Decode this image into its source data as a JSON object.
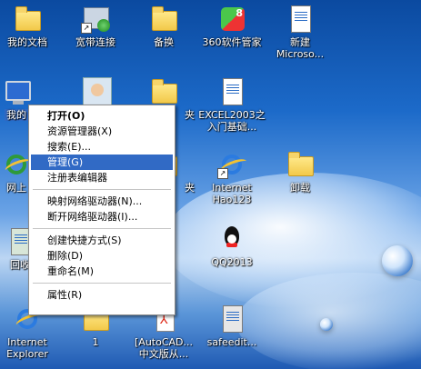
{
  "desktop_icons": [
    {
      "name": "my-documents",
      "label": "我的文档",
      "icon": "folder-icon"
    },
    {
      "name": "broadband",
      "label": "宽带连接",
      "icon": "network-connection-icon"
    },
    {
      "name": "backup",
      "label": "备换",
      "icon": "folder-icon"
    },
    {
      "name": "360-manager",
      "label": "360软件管家",
      "icon": "app-360-icon"
    },
    {
      "name": "new-microsoft",
      "label": "新建\nMicroso...",
      "icon": "document-icon"
    },
    {
      "name": "my-computer",
      "label": "我的",
      "icon": "computer-icon"
    },
    {
      "name": "user-avatar",
      "label": "",
      "icon": "avatar-icon"
    },
    {
      "name": "folder-2",
      "label": "夹",
      "icon": "folder-icon"
    },
    {
      "name": "excel2003",
      "label": "EXCEL2003之\n入门基础...",
      "icon": "document-icon"
    },
    {
      "name": "network",
      "label": "网上",
      "icon": "globe-icon"
    },
    {
      "name": "folder-3",
      "label": "夹",
      "icon": "folder-icon"
    },
    {
      "name": "ie-hao123",
      "label": "Internet\nHao123",
      "icon": "ie-icon"
    },
    {
      "name": "uninstall",
      "label": "卸载",
      "icon": "folder-icon"
    },
    {
      "name": "recycle",
      "label": "回收",
      "icon": "recycle-bin-icon"
    },
    {
      "name": "qq2013",
      "label": "QQ2013",
      "icon": "qq-icon"
    },
    {
      "name": "ie-explorer",
      "label": "Internet\nExplorer",
      "icon": "ie-icon"
    },
    {
      "name": "folder-1",
      "label": "1",
      "icon": "folder-icon"
    },
    {
      "name": "autocad",
      "label": "[AutoCAD...\n中文版从...",
      "icon": "pdf-icon"
    },
    {
      "name": "safeedit",
      "label": "safeedit...",
      "icon": "app-icon"
    }
  ],
  "context_menu": {
    "items": [
      {
        "label": "打开(O)",
        "bold": true
      },
      {
        "label": "资源管理器(X)"
      },
      {
        "label": "搜索(E)..."
      },
      {
        "label": "管理(G)",
        "highlighted": true
      },
      {
        "label": "注册表编辑器"
      },
      {
        "label": "映射网络驱动器(N)..."
      },
      {
        "label": "断开网络驱动器(I)..."
      },
      {
        "label": "创建快捷方式(S)"
      },
      {
        "label": "删除(D)"
      },
      {
        "label": "重命名(M)"
      },
      {
        "label": "属性(R)"
      }
    ]
  },
  "colors": {
    "highlight": "#316ac5",
    "desktop": "#1c6ac9"
  }
}
